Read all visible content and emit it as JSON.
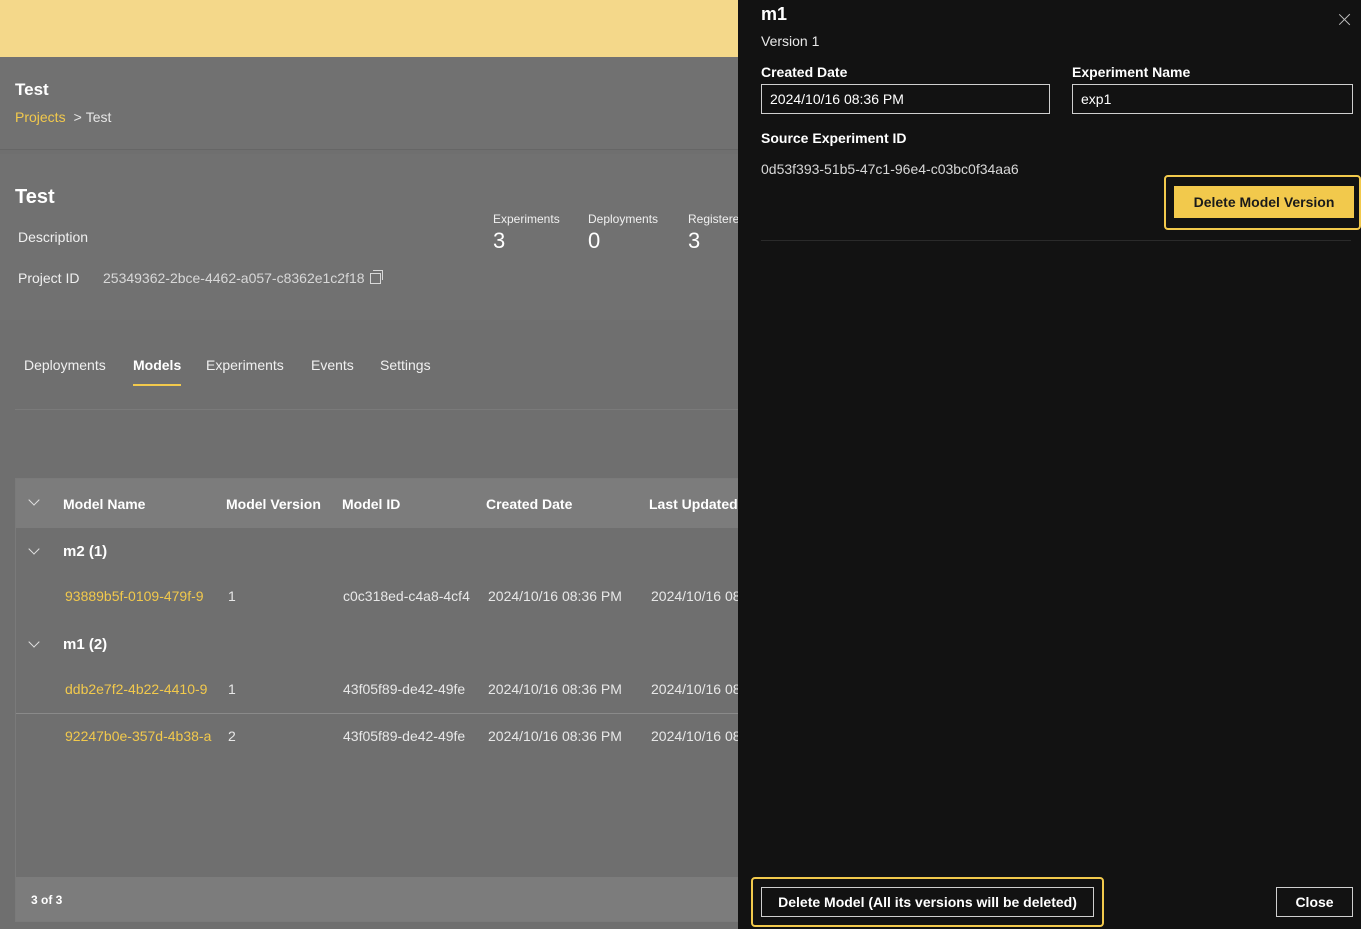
{
  "page": {
    "title": "Test",
    "breadcrumb": {
      "root": "Projects",
      "separator": ">",
      "current": "Test"
    }
  },
  "project": {
    "name": "Test",
    "description_label": "Description",
    "project_id_label": "Project ID",
    "project_id": "25349362-2bce-4462-a057-c8362e1c2f18",
    "stats": [
      {
        "label": "Experiments",
        "value": "3"
      },
      {
        "label": "Deployments",
        "value": "0"
      },
      {
        "label": "Registere",
        "value": "3"
      }
    ]
  },
  "tabs": [
    "Deployments",
    "Models",
    "Experiments",
    "Events",
    "Settings"
  ],
  "active_tab": "Models",
  "table": {
    "headers": [
      "Model Name",
      "Model Version",
      "Model ID",
      "Created Date",
      "Last Updated"
    ],
    "groups": [
      {
        "name": "m2 (1)",
        "rows": [
          {
            "model_name": "93889b5f-0109-479f-9",
            "version": "1",
            "model_id": "c0c318ed-c4a8-4cf4",
            "created": "2024/10/16 08:36 PM",
            "updated": "2024/10/16 08"
          }
        ]
      },
      {
        "name": "m1 (2)",
        "rows": [
          {
            "model_name": "ddb2e7f2-4b22-4410-9",
            "version": "1",
            "model_id": "43f05f89-de42-49fe",
            "created": "2024/10/16 08:36 PM",
            "updated": "2024/10/16 08"
          },
          {
            "model_name": "92247b0e-357d-4b38-a",
            "version": "2",
            "model_id": "43f05f89-de42-49fe",
            "created": "2024/10/16 08:36 PM",
            "updated": "2024/10/16 08"
          }
        ]
      }
    ],
    "footer": "3 of 3"
  },
  "drawer": {
    "title": "m1",
    "version": "Version 1",
    "created_date_label": "Created Date",
    "created_date": "2024/10/16 08:36 PM",
    "experiment_name_label": "Experiment Name",
    "experiment_name": "exp1",
    "source_experiment_id_label": "Source Experiment ID",
    "source_experiment_id": "0d53f393-51b5-47c1-96e4-c03bc0f34aa6",
    "delete_version_label": "Delete Model Version",
    "delete_model_label": "Delete Model (All its versions will be deleted)",
    "close_label": "Close"
  },
  "colors": {
    "accent": "#f2c94c",
    "topbar": "#f4d88a",
    "drawer_bg": "#121212",
    "overlay_bg": "#6f6f6f"
  }
}
